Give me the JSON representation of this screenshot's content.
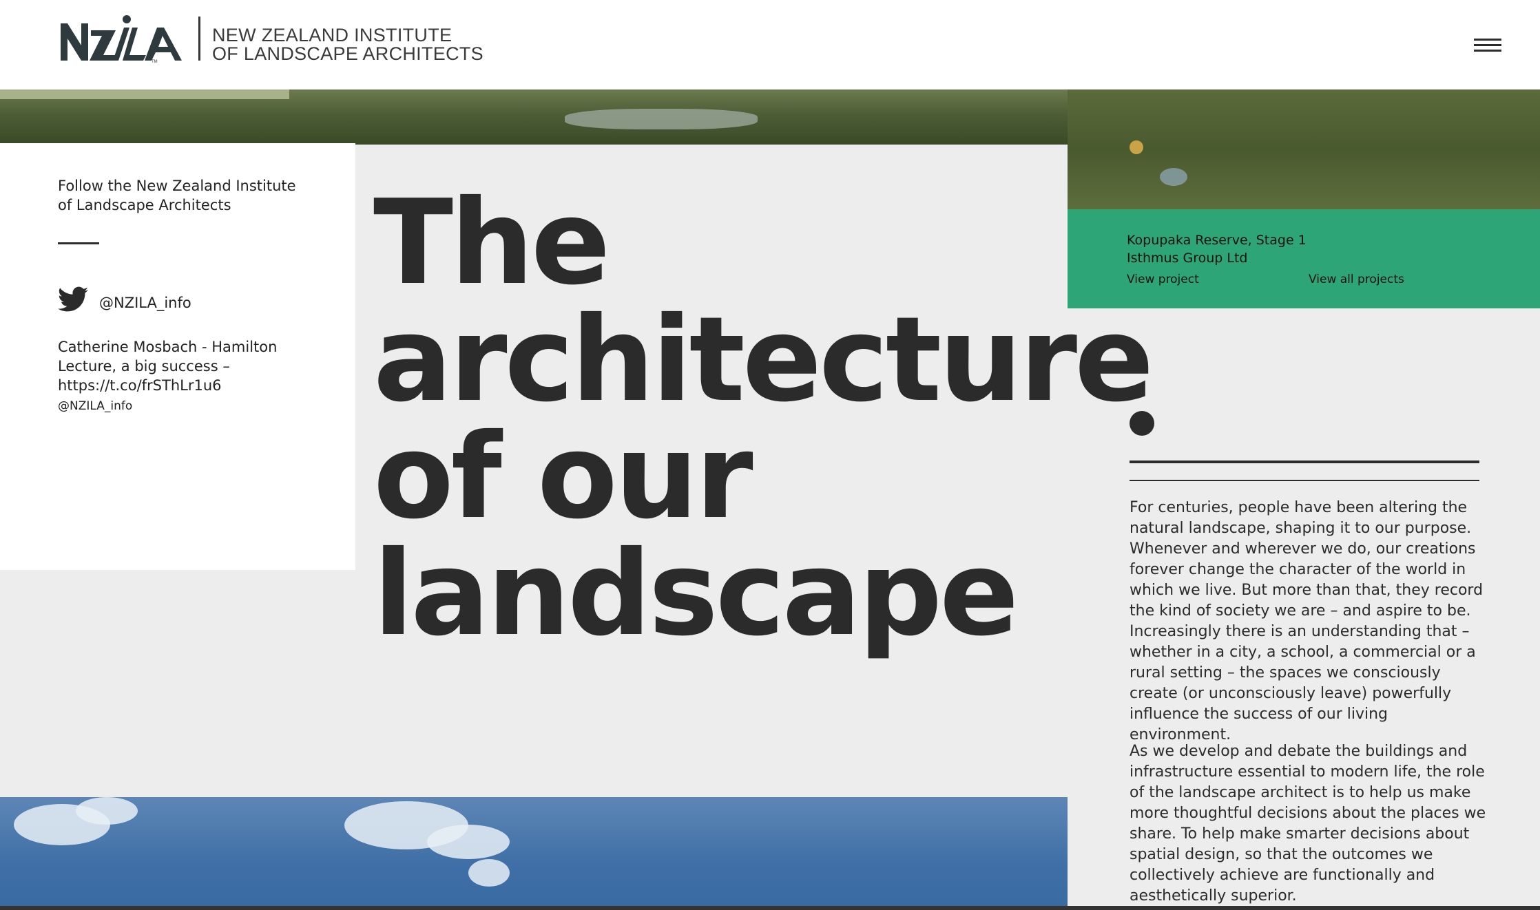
{
  "header": {
    "logo_line1": "NEW ZEALAND INSTITUTE",
    "logo_line2": "OF LANDSCAPE ARCHITECTS",
    "logo_icon": "nzila-logo",
    "menu_icon": "hamburger-menu-icon"
  },
  "sidebar": {
    "follow_text": "Follow the New Zealand Institute of Landscape Architects",
    "twitter_icon": "twitter-icon",
    "twitter_handle": "@NZILA_info",
    "tweet_text": "Catherine Mosbach - Hamilton Lecture, a big success – https://t.co/frSThLr1u6",
    "tweet_handle": "@NZILA_info"
  },
  "hero": {
    "line1": "The",
    "line2": "architecture",
    "line3": "of our",
    "line4": "landscape"
  },
  "project": {
    "name": "Kopupaka Reserve, Stage 1",
    "firm": "Isthmus Group Ltd",
    "view_project_label": "View project",
    "view_all_label": "View all projects",
    "accent_color": "#2ea577"
  },
  "intro": {
    "paragraph1": "For centuries, people have been altering the natural landscape, shaping it to our purpose. Whenever and wherever we do, our creations forever change the character of the world in which we live. But more than that, they record the kind of society we are – and aspire to be. Increasingly there is an understanding that – whether in a city, a school, a commercial or a rural setting – the spaces we consciously create (or unconsciously leave) powerfully influence the success of our living environment.",
    "paragraph2": "As we develop and debate the buildings and infrastructure essential to modern life, the role of the landscape architect is to help us make more thoughtful decisions about the places we share. To help make smarter decisions about spatial design, so that the outcomes we collectively achieve are functionally and aesthetically superior."
  }
}
